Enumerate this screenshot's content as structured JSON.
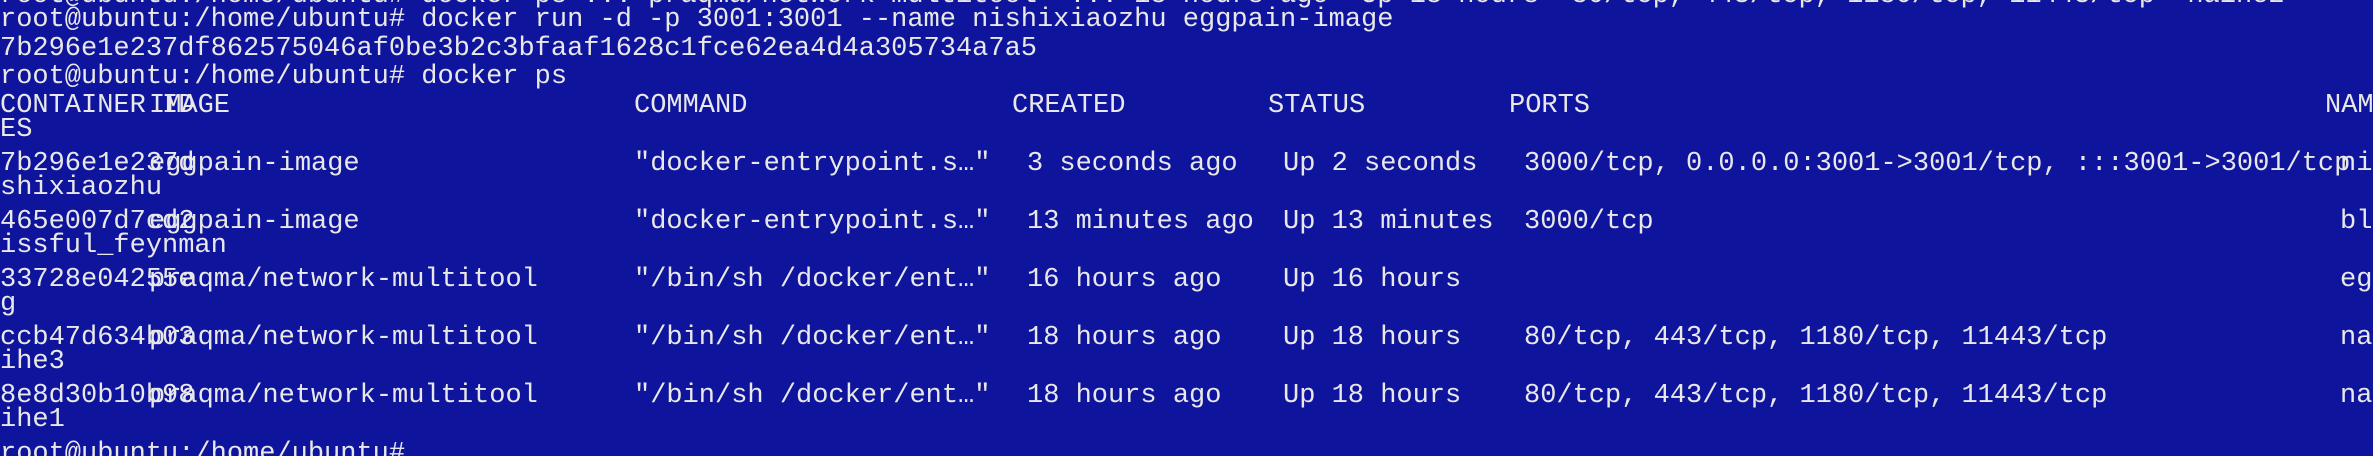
{
  "top_partial_line": "root@ubuntu:/home/ubuntu# docker ps ... praqma/network-multitool  ... 18 hours ago  Up 18 hours  80/tcp, 443/tcp, 1180/tcp, 11443/tcp  naihe2",
  "lines": [
    "root@ubuntu:/home/ubuntu# docker run -d -p 3001:3001 --name nishixiaozhu eggpain-image",
    "7b296e1e237df862575046af0be3b2c3bfaaf1628c1fce62ea4d4a305734a7a5",
    "root@ubuntu:/home/ubuntu# docker ps"
  ],
  "table": {
    "headers": {
      "container_id": "CONTAINER ID",
      "image": "IMAGE",
      "command": "COMMAND",
      "created": "CREATED",
      "status": "STATUS",
      "ports": "PORTS",
      "names_part1": "NAM",
      "names_part2": "ES"
    },
    "rows": [
      {
        "container_id": "7b296e1e237d",
        "image": "eggpain-image",
        "command": "\"docker-entrypoint.s…\"",
        "created": "3 seconds ago",
        "status": "Up 2 seconds",
        "ports": "3000/tcp, 0.0.0.0:3001->3001/tcp, :::3001->3001/tcp",
        "names_part1": "ni",
        "names_part2": "shixiaozhu"
      },
      {
        "container_id": "465e007d7cd2",
        "image": "eggpain-image",
        "command": "\"docker-entrypoint.s…\"",
        "created": "13 minutes ago",
        "status": "Up 13 minutes",
        "ports": "3000/tcp",
        "names_part1": "bl",
        "names_part2": "issful_feynman"
      },
      {
        "container_id": "33728e04255e",
        "image": "praqma/network-multitool",
        "command": "\"/bin/sh /docker/ent…\"",
        "created": "16 hours ago",
        "status": "Up 16 hours",
        "ports": "",
        "names_part1": "eg",
        "names_part2": "g"
      },
      {
        "container_id": "ccb47d634b03",
        "image": "praqma/network-multitool",
        "command": "\"/bin/sh /docker/ent…\"",
        "created": "18 hours ago",
        "status": "Up 18 hours",
        "ports": "80/tcp, 443/tcp, 1180/tcp, 11443/tcp",
        "names_part1": "na",
        "names_part2": "ihe3"
      },
      {
        "container_id": "8e8d30b10b98",
        "image": "praqma/network-multitool",
        "command": "\"/bin/sh /docker/ent…\"",
        "created": "18 hours ago",
        "status": "Up 18 hours",
        "ports": "80/tcp, 443/tcp, 1180/tcp, 11443/tcp",
        "names_part1": "na",
        "names_part2": "ihe1"
      }
    ]
  },
  "prompt": "root@ubuntu:/home/ubuntu#",
  "colors": {
    "background": "#0f149c",
    "foreground": "#e8e8e8"
  }
}
